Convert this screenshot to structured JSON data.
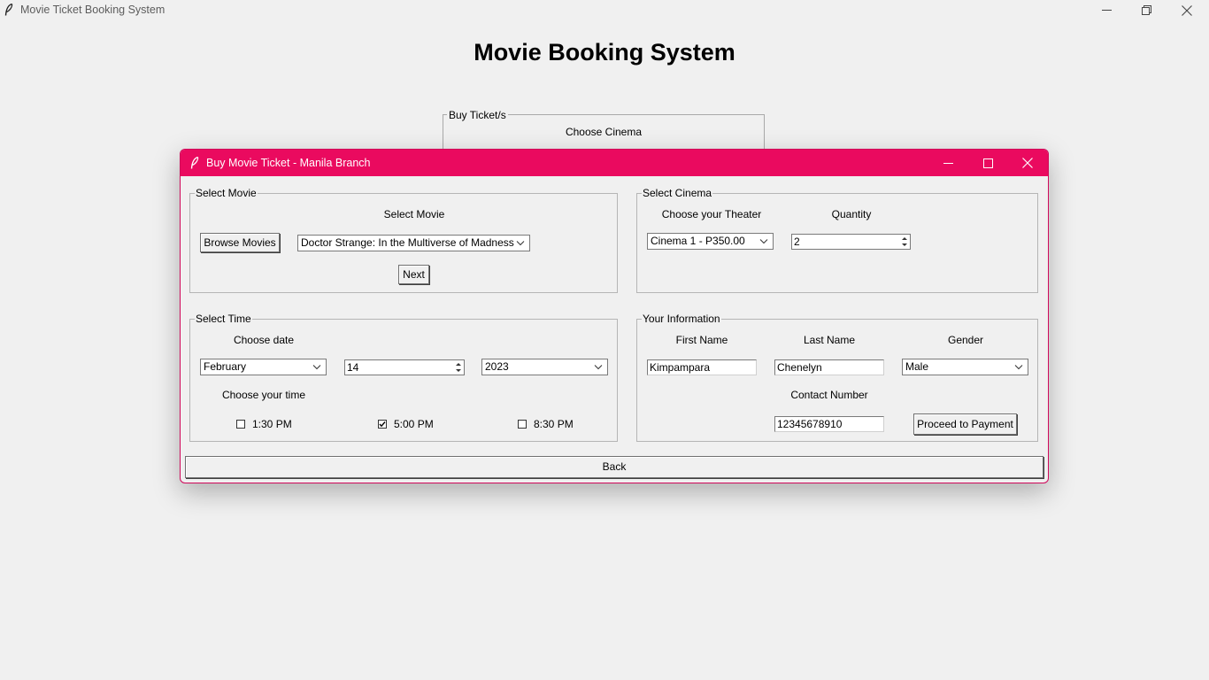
{
  "main_window": {
    "title": "Movie Ticket Booking System",
    "heading": "Movie Booking System",
    "buy_frame": {
      "legend": "Buy Ticket/s",
      "choose_cinema": "Choose Cinema"
    }
  },
  "dialog": {
    "title": "Buy Movie Ticket - Manila Branch",
    "titlebar_color": "#ea0a5f",
    "select_movie": {
      "legend": "Select Movie",
      "label": "Select Movie",
      "browse_button": "Browse Movies",
      "movie_selected": "Doctor Strange: In the Multiverse of Madness",
      "next_button": "Next"
    },
    "select_cinema": {
      "legend": "Select Cinema",
      "theater_label": "Choose your Theater",
      "quantity_label": "Quantity",
      "theater_selected": "Cinema 1 - P350.00",
      "quantity_value": "2"
    },
    "select_time": {
      "legend": "Select Time",
      "date_label": "Choose date",
      "month_selected": "February",
      "day_value": "14",
      "year_selected": "2023",
      "time_label": "Choose your time",
      "times": [
        {
          "label": "1:30 PM",
          "checked": false
        },
        {
          "label": "5:00 PM",
          "checked": true
        },
        {
          "label": "8:30 PM",
          "checked": false
        }
      ]
    },
    "your_information": {
      "legend": "Your Information",
      "first_name_label": "First Name",
      "last_name_label": "Last Name",
      "gender_label": "Gender",
      "first_name_value": "Kimpampara",
      "last_name_value": "Chenelyn",
      "gender_selected": "Male",
      "contact_label": "Contact Number",
      "contact_value": "12345678910",
      "proceed_button": "Proceed to Payment"
    },
    "back_button": "Back"
  },
  "icons": {
    "app_icon": "feather-icon",
    "minimize": "minimize-icon",
    "maximize": "maximize-icon",
    "restore": "restore-icon",
    "close": "close-icon",
    "dropdown": "chevron-down-icon",
    "spin": "spin-arrows-icon",
    "check": "checkmark-icon"
  }
}
